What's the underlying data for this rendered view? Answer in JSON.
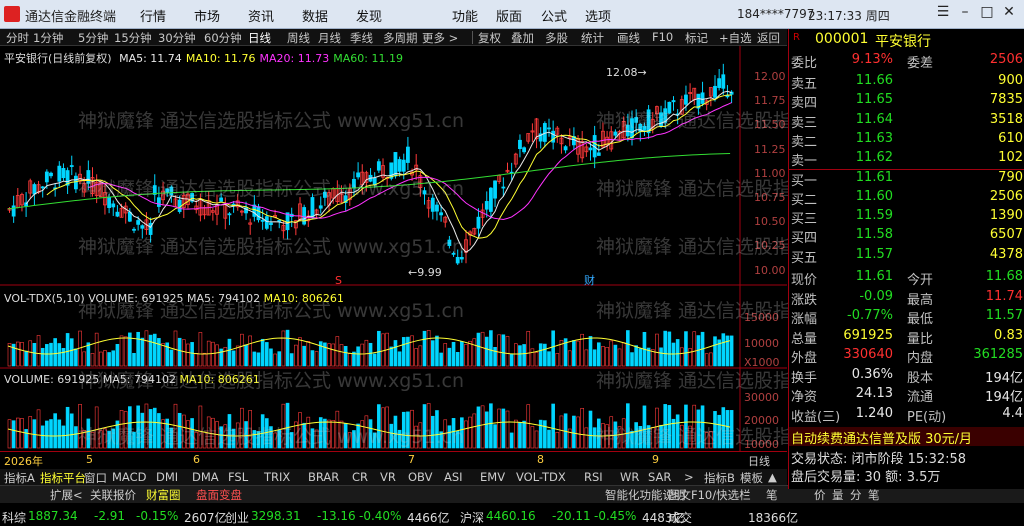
{
  "app": {
    "title": "通达信金融终端",
    "account": "184****7797",
    "clock": "23:17:33 周四"
  },
  "menu": [
    "行情",
    "市场",
    "资讯",
    "数据",
    "发现",
    "功能",
    "版面",
    "公式",
    "选项"
  ],
  "toolbar": {
    "periods": [
      "分时",
      "1分钟",
      "5分钟",
      "15分钟",
      "30分钟",
      "60分钟",
      "日线",
      "周线",
      "月线",
      "季线",
      "多周期",
      "更多 >"
    ],
    "active": "日线",
    "tools": [
      "复权",
      "叠加",
      "多股",
      "统计",
      "画线",
      "F10",
      "标记",
      "+自选",
      "返回"
    ]
  },
  "main_chart": {
    "legend_name": "平安银行(日线前复权)",
    "ma": [
      {
        "label": "MA5: 11.74",
        "color": "#e8e8e8"
      },
      {
        "label": "MA10: 11.76",
        "color": "#ffff33"
      },
      {
        "label": "MA20: 11.73",
        "color": "#ff33ff"
      },
      {
        "label": "MA60: 11.19",
        "color": "#33dd33"
      }
    ],
    "high_label": "12.08",
    "low_label": "9.99",
    "price_ticks": [
      "12.00",
      "11.75",
      "11.50",
      "11.25",
      "11.00",
      "10.75",
      "10.50",
      "10.25",
      "10.00"
    ],
    "s_marker": "S",
    "cai_marker": "财"
  },
  "vol_tdx": {
    "legend": "VOL-TDX(5,10)",
    "vol": "VOLUME: 691925",
    "ma5": "MA5: 794102",
    "ma10": "MA10: 806261",
    "ticks": [
      "15000",
      "10000",
      "X1000"
    ]
  },
  "volume": {
    "vol": "VOLUME: 691925",
    "ma5": "MA5: 794102",
    "ma10": "MA10: 806261",
    "ticks": [
      "30000",
      "20000",
      "10000",
      "X1000"
    ]
  },
  "dates": {
    "year": "2026年",
    "months": [
      "5",
      "6",
      "7",
      "8",
      "9"
    ],
    "period": "日线"
  },
  "bottom_tabs": [
    "指标A",
    "指标平台",
    "窗口",
    "MACD",
    "DMI",
    "DMA",
    "FSL",
    "TRIX",
    "BRAR",
    "CR",
    "VR",
    "OBV",
    "ASI",
    "EMV",
    "VOL-TDX",
    "RSI",
    "WR",
    "SAR",
    ">",
    "指标B",
    "模板",
    "▲"
  ],
  "status_links": [
    "扩展<",
    "关联报价",
    "财富圈",
    "盘面变盘",
    "智能化功能说明",
    "图文F10/快选栏",
    "笔",
    "价",
    "量",
    "分",
    "笔"
  ],
  "ticker": [
    {
      "name": "科综",
      "val": "1887.34",
      "chg": "-2.91",
      "pct": "-0.15%",
      "amt": "2607亿"
    },
    {
      "name": "创业",
      "val": "3298.31",
      "chg": "-13.16",
      "pct": "-0.40%",
      "amt": "4466亿"
    },
    {
      "name": "沪深",
      "val": "4460.16",
      "chg": "-20.11",
      "pct": "-0.45%",
      "amt": "4483亿"
    },
    {
      "name": "成交",
      "val": "",
      "chg": "",
      "pct": "",
      "amt": "18366亿"
    }
  ],
  "quote": {
    "code": "000001",
    "name": "平安银行",
    "weibi_label": "委比",
    "weibi": "9.13%",
    "weicha_label": "委差",
    "weicha": "2506",
    "asks": [
      {
        "l": "卖五",
        "p": "11.66",
        "v": "900"
      },
      {
        "l": "卖四",
        "p": "11.65",
        "v": "7835"
      },
      {
        "l": "卖三",
        "p": "11.64",
        "v": "3518"
      },
      {
        "l": "卖二",
        "p": "11.63",
        "v": "610"
      },
      {
        "l": "卖一",
        "p": "11.62",
        "v": "102"
      }
    ],
    "bids": [
      {
        "l": "买一",
        "p": "11.61",
        "v": "790"
      },
      {
        "l": "买二",
        "p": "11.60",
        "v": "2506"
      },
      {
        "l": "买三",
        "p": "11.59",
        "v": "1390"
      },
      {
        "l": "买四",
        "p": "11.58",
        "v": "6507"
      },
      {
        "l": "买五",
        "p": "11.57",
        "v": "4378"
      }
    ],
    "stats": [
      {
        "l1": "现价",
        "v1": "11.61",
        "c1": "green",
        "l2": "今开",
        "v2": "11.68",
        "c2": "green"
      },
      {
        "l1": "涨跌",
        "v1": "-0.09",
        "c1": "green",
        "l2": "最高",
        "v2": "11.74",
        "c2": "red"
      },
      {
        "l1": "涨幅",
        "v1": "-0.77%",
        "c1": "green",
        "l2": "最低",
        "v2": "11.57",
        "c2": "green"
      },
      {
        "l1": "总量",
        "v1": "691925",
        "c1": "yel",
        "l2": "量比",
        "v2": "0.83",
        "c2": "yel"
      },
      {
        "l1": "外盘",
        "v1": "330640",
        "c1": "red",
        "l2": "内盘",
        "v2": "361285",
        "c2": "green"
      },
      {
        "l1": "换手",
        "v1": "0.36%",
        "c1": "white",
        "l2": "股本",
        "v2": "194亿",
        "c2": "white"
      },
      {
        "l1": "净资",
        "v1": "24.13",
        "c1": "white",
        "l2": "流通",
        "v2": "194亿",
        "c2": "white"
      },
      {
        "l1": "收益(三)",
        "v1": "1.240",
        "c1": "white",
        "l2": "PE(动)",
        "v2": "4.4",
        "c2": "white"
      }
    ],
    "promo": "自动续费通达信普及版 30元/月",
    "trade_state": "交易状态: 闭市阶段 15:32:58",
    "after": "盘后交易量: 30  额: 3.5万"
  },
  "watermark": [
    "神狱魔锋  通达信选股指标公式 www.xg51.cn"
  ]
}
